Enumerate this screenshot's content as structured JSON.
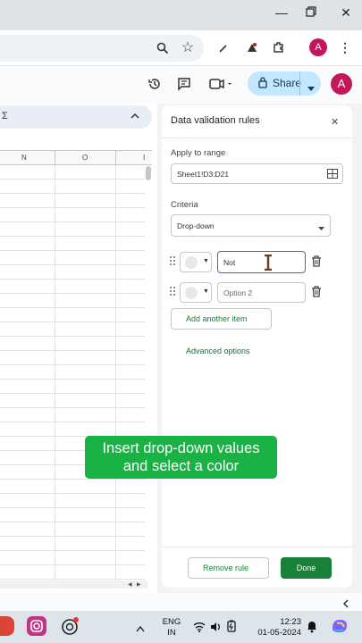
{
  "browser": {
    "avatar_letter": "A"
  },
  "formula_bar": {
    "sigma": "Σ"
  },
  "columns": [
    "N",
    "O",
    "I"
  ],
  "toolbar": {
    "share_label": "Share",
    "avatar_letter": "A"
  },
  "panel": {
    "title": "Data validation rules",
    "apply_label": "Apply to range",
    "range_value": "Sheet1!D3:D21",
    "criteria_label": "Criteria",
    "criteria_value": "Drop-down",
    "items": [
      {
        "value": "Not",
        "placeholder": ""
      },
      {
        "value": "",
        "placeholder": "Option 2"
      }
    ],
    "add_item_label": "Add another item",
    "advanced_label": "Advanced options",
    "remove_label": "Remove rule",
    "done_label": "Done"
  },
  "overlay": {
    "line1": "Insert drop-down values",
    "line2": "and select a color"
  },
  "taskbar": {
    "lang1": "ENG",
    "lang2": "IN",
    "time": "12:23",
    "date": "01-05-2024"
  },
  "colors": {
    "accent_green": "#188038",
    "share_bg": "#c2e7ff",
    "overlay_green": "#18b245",
    "panel_link": "#137333"
  }
}
